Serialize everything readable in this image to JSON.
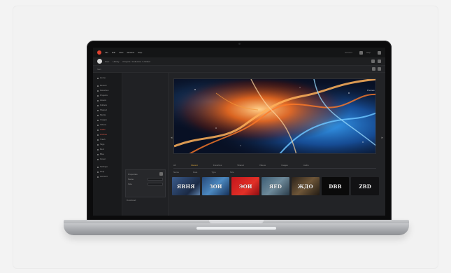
{
  "app": {
    "menu": [
      "File",
      "Edit",
      "View",
      "Window",
      "Help"
    ],
    "title_right": [
      "Account",
      "Help"
    ]
  },
  "toolbar": {
    "user": "User",
    "crumb": "Library",
    "path": "Projects / Collection / Untitled"
  },
  "subbar": {
    "label": "Sort"
  },
  "sidebar": {
    "items": [
      "Home",
      "Recent",
      "Favorites",
      "Projects",
      "Assets",
      "Folders",
      "Shared",
      "Media",
      "Images",
      "Videos",
      "Audio",
      "Archive",
      "Trash",
      "Tags",
      "Red",
      "Blue",
      "Green"
    ],
    "bottom": [
      "Settings",
      "Help",
      "Account"
    ]
  },
  "browser": {
    "panel_title": "Properties",
    "row1_label": "Name",
    "row2_label": "Size",
    "footer": "Download"
  },
  "main": {
    "hero_label": "Preview",
    "tabs": [
      "All",
      "Recent",
      "Favorites",
      "Shared",
      "Videos",
      "Images",
      "Audio"
    ],
    "thumb_headers": [
      "Name",
      "Date",
      "Type",
      "Size"
    ],
    "thumbnails": [
      "ЯВНЯ",
      "ЗOИ",
      "ЭОИ",
      "ЯED",
      "ЖДО",
      "DBB",
      "ZBD"
    ]
  },
  "colors": {
    "accent": "#e0412f",
    "tab_active": "#d9a63a",
    "bg": "#1b1c1e"
  }
}
